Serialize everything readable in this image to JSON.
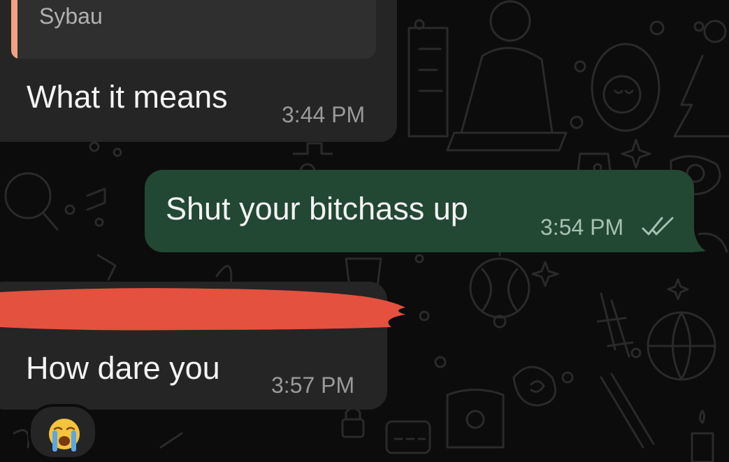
{
  "messages": [
    {
      "direction": "incoming",
      "quoted_text": "Sybau",
      "text": "What it means",
      "time": "3:44 PM"
    },
    {
      "direction": "outgoing",
      "text": "Shut your bitchass up",
      "time": "3:54 PM",
      "status_icon": "double-check-read-icon"
    },
    {
      "direction": "incoming",
      "quoted_text_redacted": true,
      "text": "How dare you",
      "time": "3:57 PM",
      "reaction_icon": "loudly-crying-face-emoji"
    }
  ],
  "colors": {
    "background": "#0c0c0c",
    "incoming_bubble": "#252525",
    "outgoing_bubble": "#224733",
    "quote_bar": "#f2a184",
    "redaction_mark": "#e4513e"
  }
}
